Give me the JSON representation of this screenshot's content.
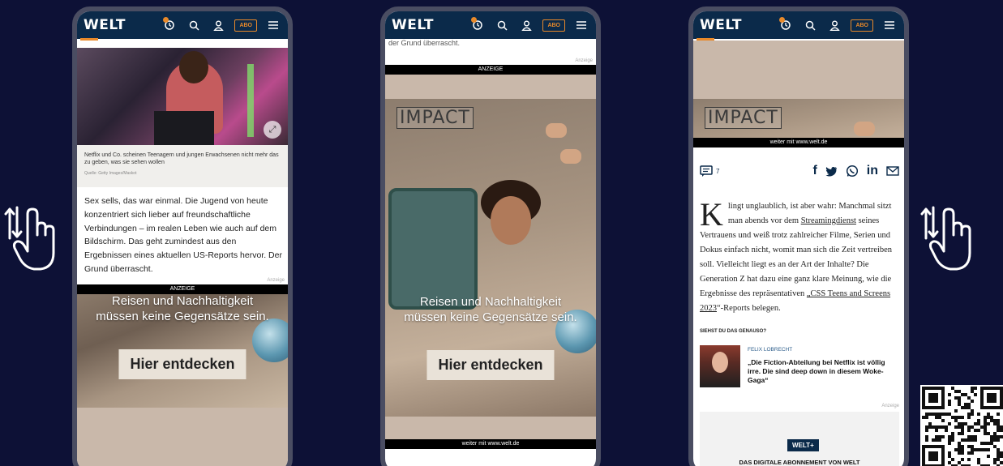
{
  "brand": {
    "logo": "WELT",
    "abo": "ABO",
    "accent": "#e8892a",
    "navy": "#0b2a4a"
  },
  "phone1": {
    "caption": "Netflix und Co. scheinen Teenagern und jungen Erwachsenen nicht mehr das zu geben, was sie sehen wollen",
    "source": "Quelle: Getty Images/Maskot",
    "body": "Sex sells, das war einmal. Die Jugend von heute konzentriert sich lieber auf freundschaftliche Verbindungen – im realen Leben wie auch auf dem Bildschirm. Das geht zumindest aus den Ergebnissen eines aktuellen US-Reports hervor. Der Grund überrascht.",
    "anzeige_small": "Anzeige",
    "ad_label": "ANZEIGE",
    "ad_line1": "Reisen und Nachhaltigkeit",
    "ad_line2": "müssen keine Gegensätze sein.",
    "ad_cta": "Hier entdecken"
  },
  "phone2": {
    "top_text": "der Grund überrascht.",
    "anzeige_small": "Anzeige",
    "ad_label": "ANZEIGE",
    "impact": "IMPACT",
    "ad_line1": "Reisen und Nachhaltigkeit",
    "ad_line2": "müssen keine Gegensätze sein.",
    "ad_cta": "Hier entdecken",
    "weiter": "weiter mit www.welt.de"
  },
  "phone3": {
    "impact": "IMPACT",
    "weiter": "weiter mit www.welt.de",
    "comment_count": "7",
    "dropcap": "K",
    "article_a": "lingt unglaublich, ist aber wahr: Manchmal sitzt man abends vor dem ",
    "article_link1": "Streamingdienst",
    "article_b": " seines Vertrauens und weiß trotz zahlreicher Filme, Serien und Dokus einfach nicht, womit man sich die Zeit vertreiben soll. Vielleicht liegt es an der Art der Inhalte? Die Generation Z hat dazu eine ganz klare Meinung, wie die Ergebnisse des repräsentativen ",
    "article_link2": "„CSS Teens and Screens 2023",
    "article_c": "“-Reports belegen.",
    "siehst": "SIEHST DU DAS GENAUSO?",
    "teaser_author": "FELIX LOBRECHT",
    "teaser_title": "„Die Fiction-Abteilung bei Netflix ist völlig irre. Die sind deep down in diesem Woke-Gaga“",
    "anzeige_small": "Anzeige",
    "weltplus_badge": "WELT+",
    "weltplus_text": "DAS DIGITALE ABONNEMENT VON WELT"
  }
}
